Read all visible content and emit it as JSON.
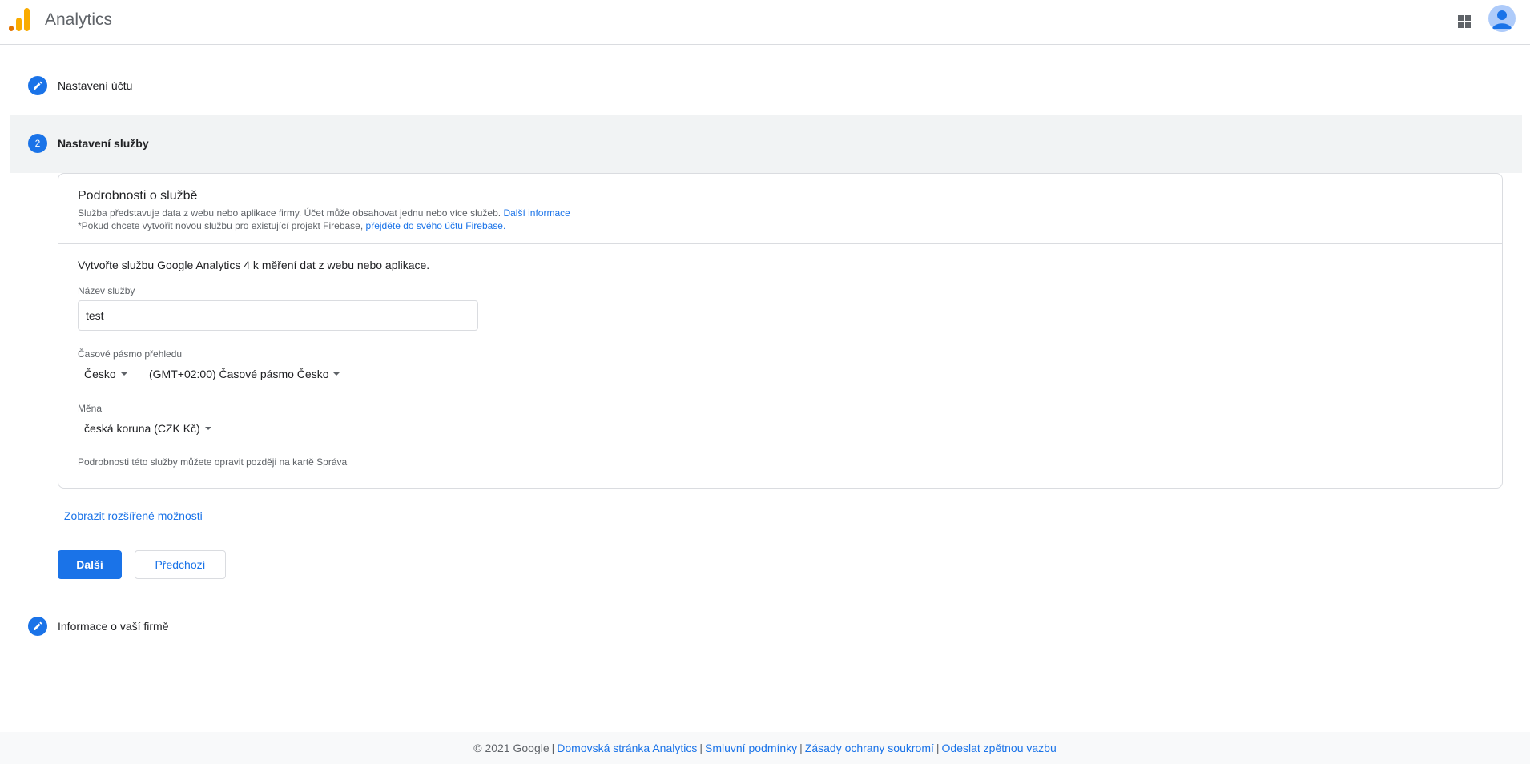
{
  "header": {
    "app_title": "Analytics",
    "apps_icon": "apps-grid-icon",
    "avatar_icon": "account-avatar-icon",
    "logo_colors": [
      "#F9AB00",
      "#E37400"
    ]
  },
  "stepper": {
    "steps": [
      {
        "label": "Nastavení účtu",
        "icon": "pencil-icon",
        "state": "completed"
      },
      {
        "label": "Nastavení služby",
        "number": "2",
        "state": "active"
      },
      {
        "label": "Informace o vaší firmě",
        "icon": "pencil-icon",
        "state": "pending"
      }
    ]
  },
  "card": {
    "title": "Podrobnosti o službě",
    "desc1": "Služba představuje data z webu nebo aplikace firmy. Účet může obsahovat jednu nebo více služeb.",
    "desc1_link": "Další informace",
    "desc2": "*Pokud chcete vytvořit novou službu pro existující projekt Firebase,",
    "desc2_link": "přejděte do svého účtu Firebase",
    "desc2_end": ".",
    "intro": "Vytvořte službu Google Analytics 4 k měření dat z webu nebo aplikace.",
    "name_label": "Název služby",
    "name_value": "test",
    "tz_label": "Časové pásmo přehledu",
    "tz_country": "Česko",
    "tz_zone": "(GMT+02:00) Časové pásmo Česko",
    "currency_label": "Měna",
    "currency_value": "česká koruna (CZK Kč)",
    "note": "Podrobnosti této služby můžete opravit později na kartě Správa"
  },
  "advanced_link": "Zobrazit rozšířené možnosti",
  "buttons": {
    "next": "Další",
    "previous": "Předchozí"
  },
  "footer": {
    "copyright": "© 2021 Google",
    "links": [
      "Domovská stránka Analytics",
      "Smluvní podmínky",
      "Zásady ochrany soukromí",
      "Odeslat zpětnou vazbu"
    ]
  },
  "colors": {
    "accent": "#1a73e8",
    "border": "#dadce0",
    "active_step_bg": "#f1f3f4"
  }
}
